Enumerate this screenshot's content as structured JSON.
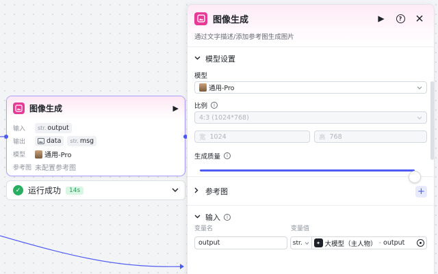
{
  "node": {
    "title": "图像生成",
    "rows": {
      "input_label": "输入",
      "input_type": "str.",
      "input_value": "output",
      "output_label": "输出",
      "output_tags": [
        {
          "type": "image-icon",
          "value": "data"
        },
        {
          "type": "str.",
          "value": "msg"
        }
      ],
      "model_label": "模型",
      "model_value": "通用-Pro",
      "ref_label": "参考图",
      "ref_value": "未配置参考图"
    }
  },
  "status": {
    "text": "运行成功",
    "time": "14s"
  },
  "panel": {
    "title": "图像生成",
    "description": "通过文字描述/添加参考图生成图片",
    "model_section": {
      "title": "模型设置",
      "model_label": "模型",
      "model_value": "通用-Pro",
      "ratio_label": "比例",
      "ratio_value": "4:3 (1024*768)",
      "width_prefix": "宽",
      "width_value": "1024",
      "height_prefix": "高",
      "height_value": "768",
      "quality_label": "生成质量",
      "quality_level": 1.0
    },
    "reference_section": {
      "title": "参考图"
    },
    "input_section": {
      "title": "输入",
      "col_name": "变量名",
      "col_value": "变量值",
      "var_name": "output",
      "var_type": "str.",
      "ref_source": "大模型（主人物）",
      "ref_sep": "-",
      "ref_field": "output"
    }
  },
  "colors": {
    "accent": "#4e5bf2",
    "brand_pink": "#e63a97",
    "success": "#27ae60",
    "node_border": "#a8a1ff"
  }
}
